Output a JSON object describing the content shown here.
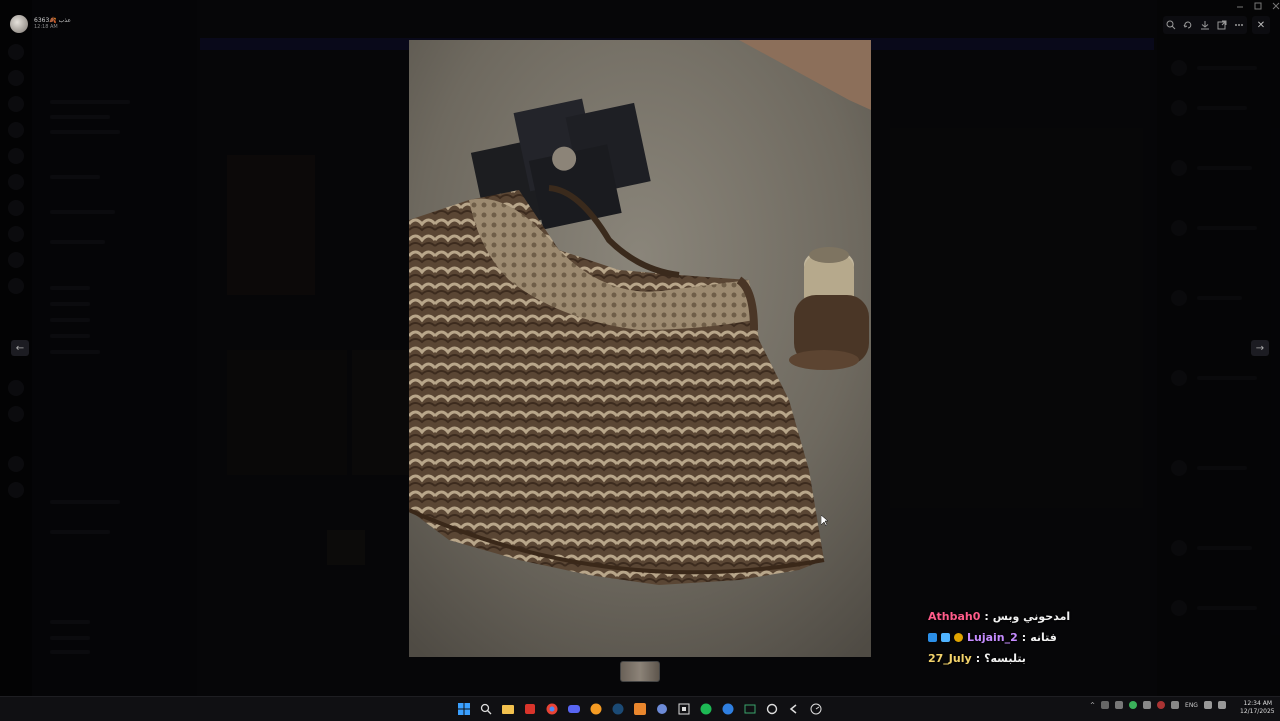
{
  "user": {
    "name": "عذب 🍂6363",
    "time": "12:18 AM"
  },
  "viewer": {
    "prev_arrow": "←",
    "next_arrow": "→",
    "close": "✕"
  },
  "chat_overlay": [
    {
      "user": "Athbah0",
      "message": "امدحوني وبس"
    },
    {
      "user": "Lujain_2",
      "message": "فتانه"
    },
    {
      "user": "27_July",
      "message": "بتلبسه؟"
    }
  ],
  "taskbar": {
    "lang": "ENG",
    "time": "12:34 AM",
    "date": "12/17/2025"
  },
  "colors": {
    "accent_user1": "#ff5c8a",
    "accent_user2": "#c58cff",
    "accent_user3": "#f3d36b"
  }
}
